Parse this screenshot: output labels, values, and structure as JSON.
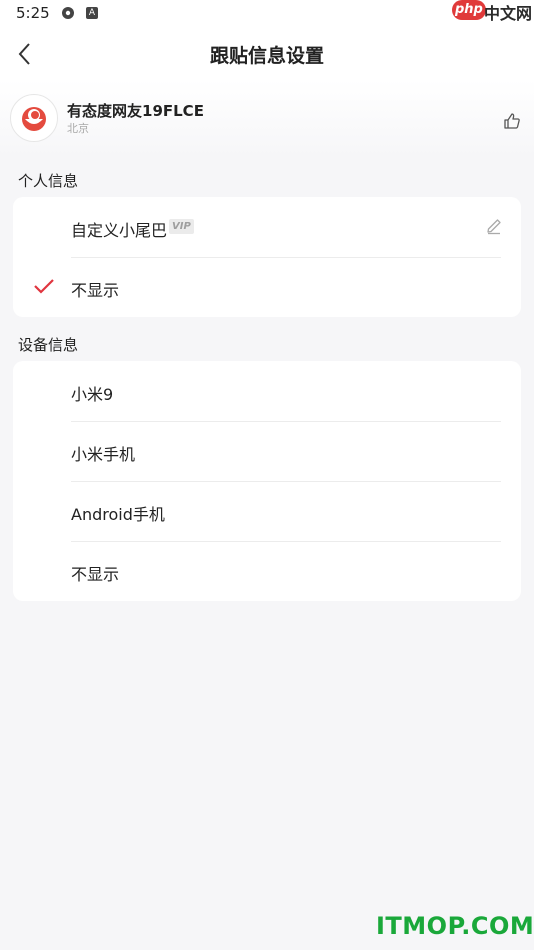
{
  "status_bar": {
    "time": "5:25"
  },
  "watermark_top": {
    "php": "php",
    "cn": "中文网"
  },
  "header": {
    "title": "跟贴信息设置"
  },
  "profile": {
    "username": "有态度网友19FLCE",
    "location": "北京"
  },
  "personal_section": {
    "title": "个人信息",
    "items": [
      {
        "label": "自定义小尾巴",
        "badge": "VIP",
        "selected": false
      },
      {
        "label": "不显示",
        "selected": true
      }
    ]
  },
  "device_section": {
    "title": "设备信息",
    "items": [
      {
        "label": "小米9"
      },
      {
        "label": "小米手机"
      },
      {
        "label": "Android手机"
      },
      {
        "label": "不显示"
      }
    ]
  },
  "watermark_bottom": "ITMOP.COM",
  "colors": {
    "accent": "#e0353f",
    "background": "#f6f6f8",
    "card": "#ffffff"
  }
}
